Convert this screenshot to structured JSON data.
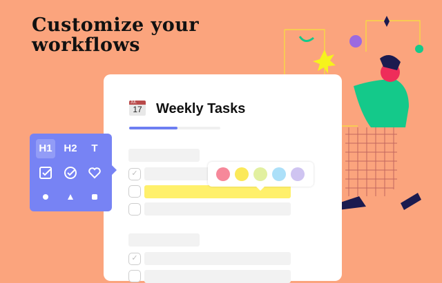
{
  "headline": {
    "line1": "Customize your",
    "line2": "workflows"
  },
  "card": {
    "calendar_month": "JUL",
    "calendar_day": "17",
    "title": "Weekly Tasks",
    "progress_percent": 53
  },
  "toolbar": {
    "h1": "H1",
    "h2": "H2",
    "t": "T"
  },
  "colors": {
    "background": "#fba47d",
    "accent": "#7783f4",
    "highlight": "#fff06b"
  },
  "swatches": [
    "#f6889a",
    "#fbe95a",
    "#e2f0a0",
    "#ace0f9",
    "#cfc4f1"
  ]
}
